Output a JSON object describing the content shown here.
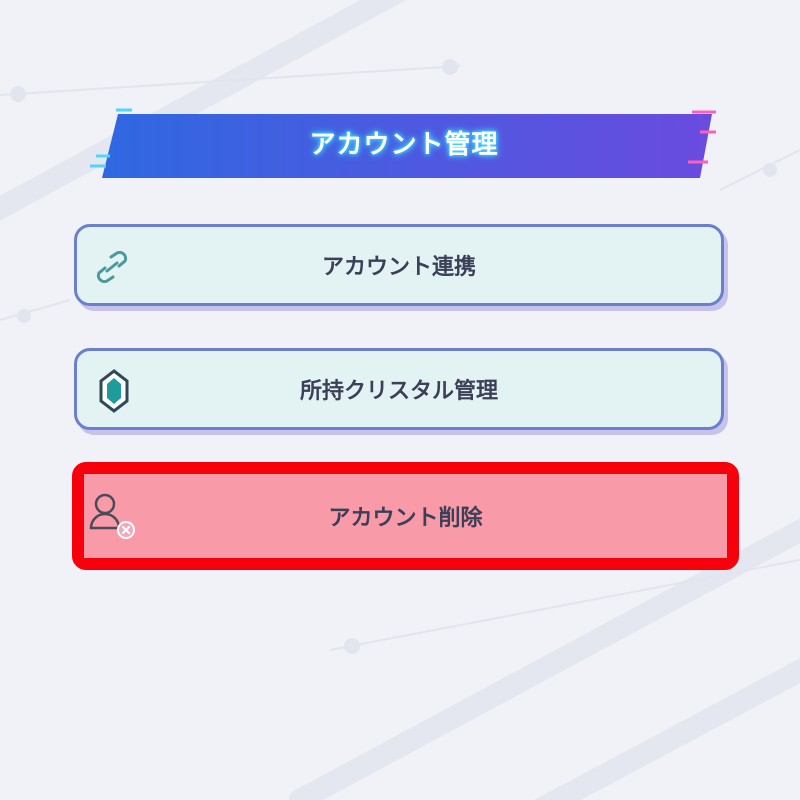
{
  "page": {
    "title": "アカウント管理"
  },
  "menu": {
    "items": [
      {
        "label": "アカウント連携",
        "icon": "link-icon"
      },
      {
        "label": "所持クリスタル管理",
        "icon": "crystal-icon"
      },
      {
        "label": "アカウント削除",
        "icon": "user-remove-icon",
        "highlighted": true
      }
    ]
  },
  "colors": {
    "background": "#f1f2f8",
    "banner_start": "#2f68e0",
    "banner_end": "#6a4be0",
    "button_fill": "#e3f3f3",
    "button_border": "#6a80cc",
    "danger_fill": "#f89aa8",
    "highlight_outline": "#f5000b",
    "text": "#3b3f57"
  }
}
